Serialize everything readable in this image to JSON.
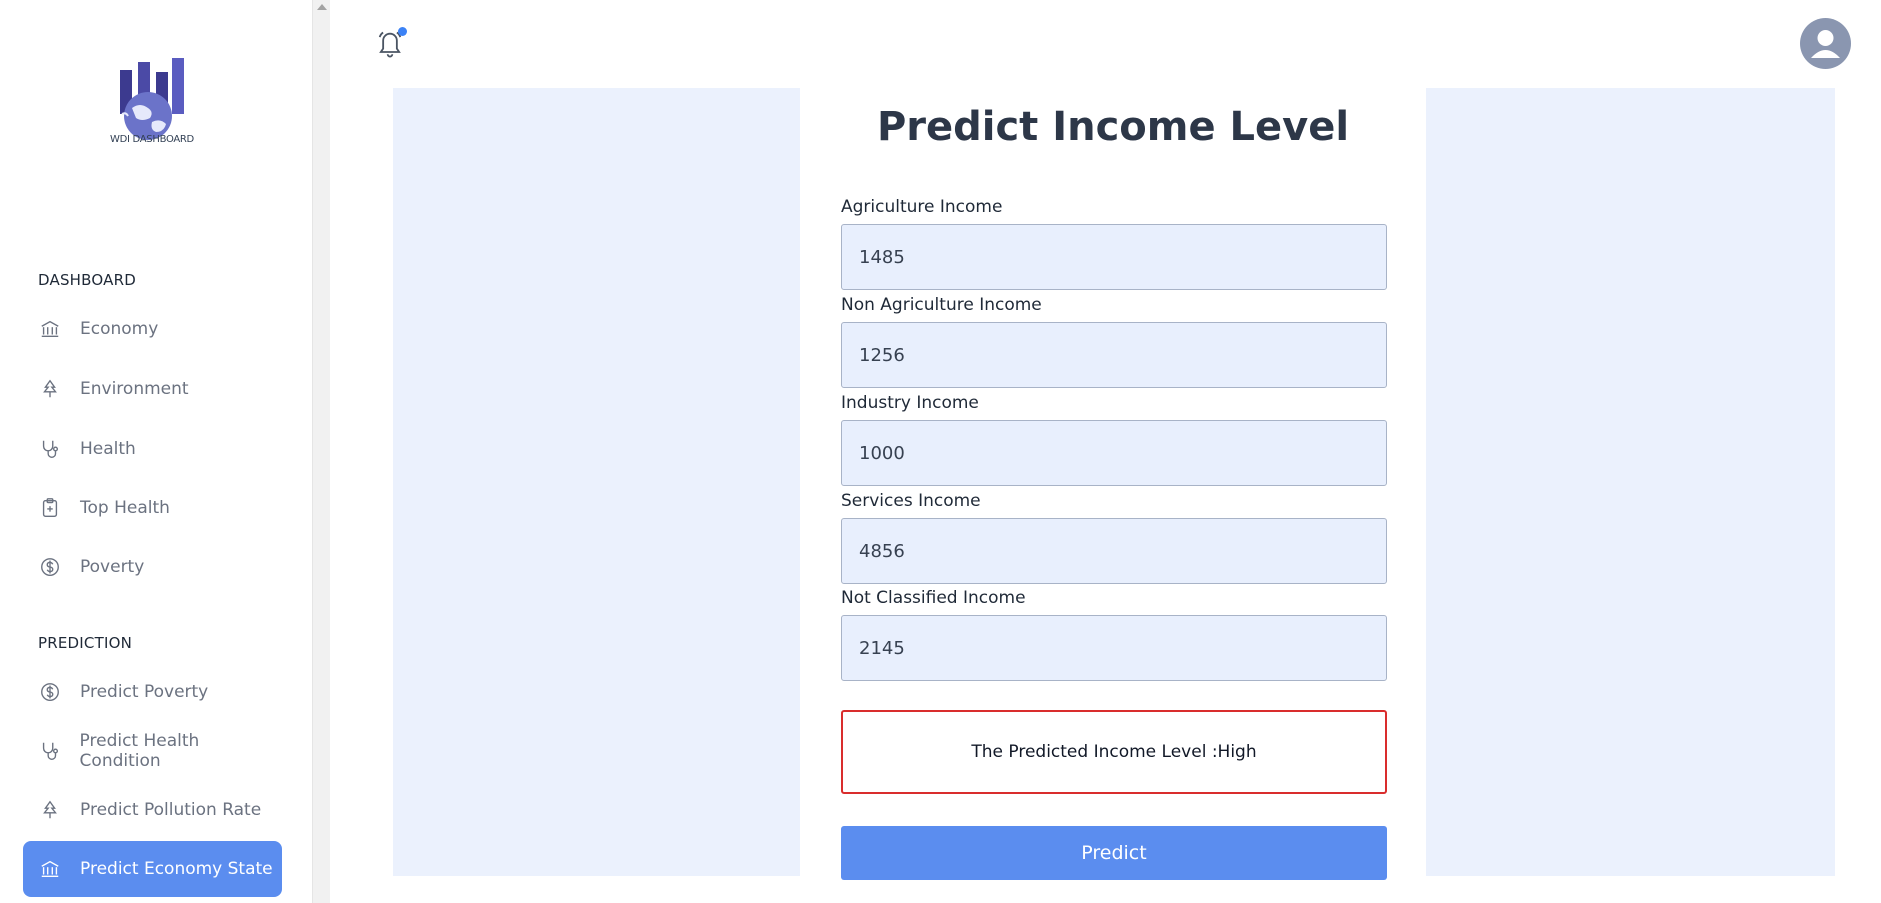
{
  "sidebar": {
    "logo_caption": "WDI DASHBOARD",
    "dashboard_title": "DASHBOARD",
    "dashboard_items": [
      {
        "label": "Economy",
        "icon": "bank-icon"
      },
      {
        "label": "Environment",
        "icon": "tree-icon"
      },
      {
        "label": "Health",
        "icon": "stethoscope-icon"
      },
      {
        "label": "Top Health",
        "icon": "clipboard-plus-icon"
      },
      {
        "label": "Poverty",
        "icon": "dollar-circle-icon"
      }
    ],
    "prediction_title": "PREDICTION",
    "prediction_items": [
      {
        "label": "Predict Poverty",
        "icon": "dollar-circle-icon"
      },
      {
        "label": "Predict Health Condition",
        "icon": "stethoscope-icon"
      },
      {
        "label": "Predict Pollution Rate",
        "icon": "tree-icon"
      },
      {
        "label": "Predict Economy State",
        "icon": "bank-icon",
        "active": true
      }
    ]
  },
  "form": {
    "title": "Predict Income Level",
    "fields": [
      {
        "label": "Agriculture Income",
        "value": "1485"
      },
      {
        "label": "Non Agriculture Income",
        "value": "1256"
      },
      {
        "label": "Industry Income",
        "value": "1000"
      },
      {
        "label": "Services Income",
        "value": "4856"
      },
      {
        "label": "Not Classified Income",
        "value": "2145"
      }
    ],
    "result": "The Predicted Income Level :High",
    "submit_label": "Predict"
  },
  "colors": {
    "accent": "#5b8def",
    "result_border": "#d92d2d",
    "input_bg": "#e8effd",
    "content_bg": "#ebf1fd"
  }
}
